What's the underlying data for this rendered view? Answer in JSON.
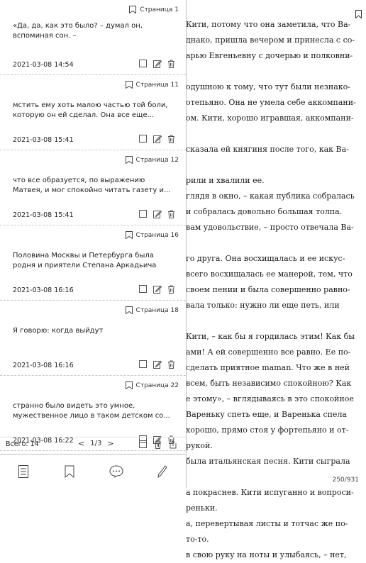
{
  "reader": {
    "lines": [
      "Кити, потому что она заметила, что Ва-",
      "днако, пришла вечером и принесла с со-",
      "арью Евгеньевну с дочерью и полковни-",
      "",
      "одушною к тому, что тут были незнако-",
      "отепьяно. Она не умела себе аккомпани-",
      "ом. Кити, хорошо игравшая, аккомпани-",
      "",
      "сказала ей княгиня после того, как Ва-",
      "",
      "рили и хвалили ее.",
      "глядя в окно, – какая публика собралась",
      "и собралась довольно большая толпа.",
      "вам удовольствие, – просто отвечала Ва-",
      "",
      "го друга. Она восхищалась и ее искус-",
      "всего восхищалась ее манерой, тем, что",
      "своем пении и была совершенно равно-",
      "вала только: нужно ли еще петь, или",
      "",
      "Кити, – как бы я гордилась этим! Как бы",
      "ами! А ей совершенно все равно. Ее по-",
      "сделать приятное maman. Что же в ней",
      "всем, быть независимо спокойною? Как",
      "е этому», – вглядываясь в это спокойное",
      "Вареньку спеть еще, и Варенька спела",
      "хорошо, прямо стоя у фортепьяно и от-",
      "рукой.",
      "была итальянская песня. Кити сыграла",
      "",
      "а покраснев. Кити испуганно и вопроси-",
      "реньки.",
      "а, перевертывая листы и тотчас же по-",
      "то-то.",
      "в свою руку на ноты и улыбаясь, – нет,"
    ],
    "page_counter": "250/931"
  },
  "panel": {
    "entries": [
      {
        "page": "Страница 1",
        "excerpt": "«Да, да, как это было? – думал он, вспоминая сон. –",
        "date": "2021-03-08 14:54"
      },
      {
        "page": "Страница 11",
        "excerpt": "мстить ему хоть малою частью той боли, которую он ей сделал. Она все еще...",
        "date": "2021-03-08 15:41"
      },
      {
        "page": "Страница 12",
        "excerpt": "что все образуется, по выражению Матвея, и мог спокойно читать газету и...",
        "date": "2021-03-08 15:41"
      },
      {
        "page": "Страница 16",
        "excerpt": "Половина Москвы и Петербурга была родня и приятели Степана Аркадьича",
        "date": "2021-03-08 16:16"
      },
      {
        "page": "Страница 18",
        "excerpt": "Я говорю: когда выйдут",
        "date": "2021-03-08 16:16"
      },
      {
        "page": "Страница 22",
        "excerpt": "странно было видеть это умное, мужественное лицо в таком детском со...",
        "date": "2021-03-08 16:22"
      }
    ],
    "footer": {
      "total": "Всего: 14",
      "prev": "<",
      "pager": "1/3",
      "next": ">"
    },
    "tabs": [
      "contents-tab",
      "bookmarks-tab",
      "notes-tab",
      "annotations-tab"
    ]
  }
}
